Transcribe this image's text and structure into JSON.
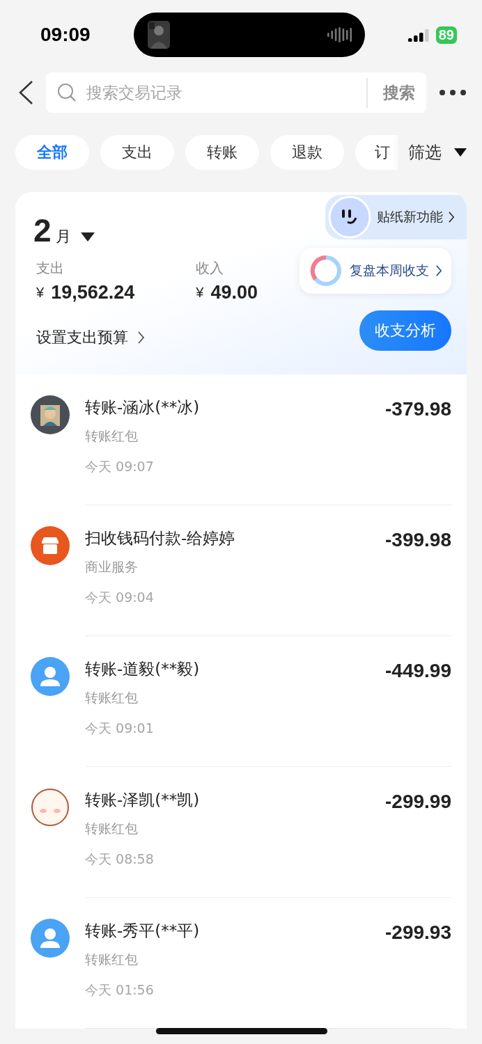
{
  "status_bar": {
    "time": "09:09",
    "battery": "89"
  },
  "search": {
    "placeholder": "搜索交易记录",
    "button": "搜索"
  },
  "filters": [
    {
      "label": "全部",
      "selected": true
    },
    {
      "label": "支出",
      "selected": false
    },
    {
      "label": "转账",
      "selected": false
    },
    {
      "label": "退款",
      "selected": false
    },
    {
      "label": "订",
      "selected": false
    }
  ],
  "filter_menu": "筛选",
  "summary": {
    "month": "2",
    "month_unit": "月",
    "expense_label": "支出",
    "expense_currency": "¥",
    "expense": "19,562.24",
    "income_label": "收入",
    "income_currency": "¥",
    "income": "49.00",
    "budget_link": "设置支出预算",
    "sticker_link": "贴纸新功能",
    "weekly_review": "复盘本周收支",
    "analysis_button": "收支分析"
  },
  "transactions": [
    {
      "title": "转账-涵冰(**冰)",
      "category": "转账红包",
      "time": "今天 09:07",
      "amount": "-379.98"
    },
    {
      "kind": "shop",
      "title": "扫收钱码付款-给婷婷",
      "category": "商业服务",
      "time": "今天 09:04",
      "amount": "-399.98"
    },
    {
      "kind": "person",
      "title": "转账-道毅(**毅)",
      "category": "转账红包",
      "time": "今天 09:01",
      "amount": "-449.99"
    },
    {
      "kind": "blush",
      "title": "转账-泽凯(**凯)",
      "category": "转账红包",
      "time": "今天 08:58",
      "amount": "-299.99"
    },
    {
      "kind": "person",
      "title": "转账-秀平(**平)",
      "category": "转账红包",
      "time": "今天 01:56",
      "amount": "-299.93"
    }
  ]
}
